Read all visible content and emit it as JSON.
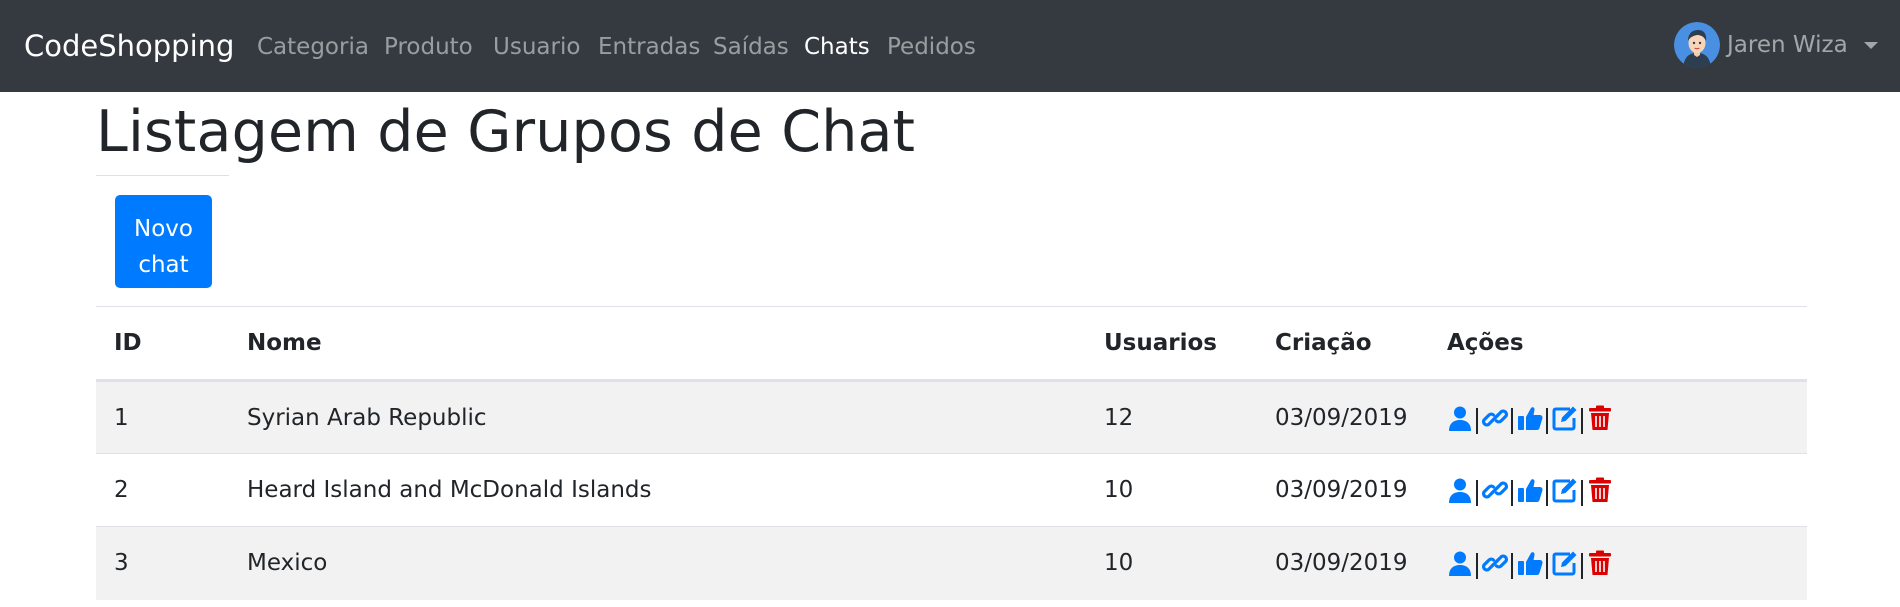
{
  "navbar": {
    "brand": "CodeShopping",
    "links": [
      {
        "label": "Categoria",
        "active": false
      },
      {
        "label": "Produto",
        "active": false
      },
      {
        "label": "Usuario",
        "active": false
      },
      {
        "label": "Entradas",
        "active": false
      },
      {
        "label": "Saídas",
        "active": false
      },
      {
        "label": "Chats",
        "active": true
      },
      {
        "label": "Pedidos",
        "active": false
      }
    ],
    "user": {
      "name": "Jaren Wiza",
      "avatar_icon": "avatar-icon",
      "menu_icon": "caret-down-icon"
    }
  },
  "page": {
    "title": "Listagem de Grupos de Chat",
    "new_button": {
      "line1": "Novo",
      "line2": "chat"
    }
  },
  "table": {
    "headers": {
      "id": "ID",
      "nome": "Nome",
      "usuarios": "Usuarios",
      "criacao": "Criação",
      "acoes": "Ações"
    },
    "rows": [
      {
        "id": "1",
        "nome": "Syrian Arab Republic",
        "usuarios": "12",
        "criacao": "03/09/2019"
      },
      {
        "id": "2",
        "nome": "Heard Island and McDonald Islands",
        "usuarios": "10",
        "criacao": "03/09/2019"
      },
      {
        "id": "3",
        "nome": "Mexico",
        "usuarios": "10",
        "criacao": "03/09/2019"
      }
    ],
    "action_icons": [
      "user-icon",
      "link-icon",
      "thumbs-up-icon",
      "edit-icon",
      "trash-icon"
    ]
  },
  "colors": {
    "navbar_bg": "#343a40",
    "primary": "#007bff",
    "danger": "#dc3545",
    "stripe": "#f2f2f2"
  }
}
